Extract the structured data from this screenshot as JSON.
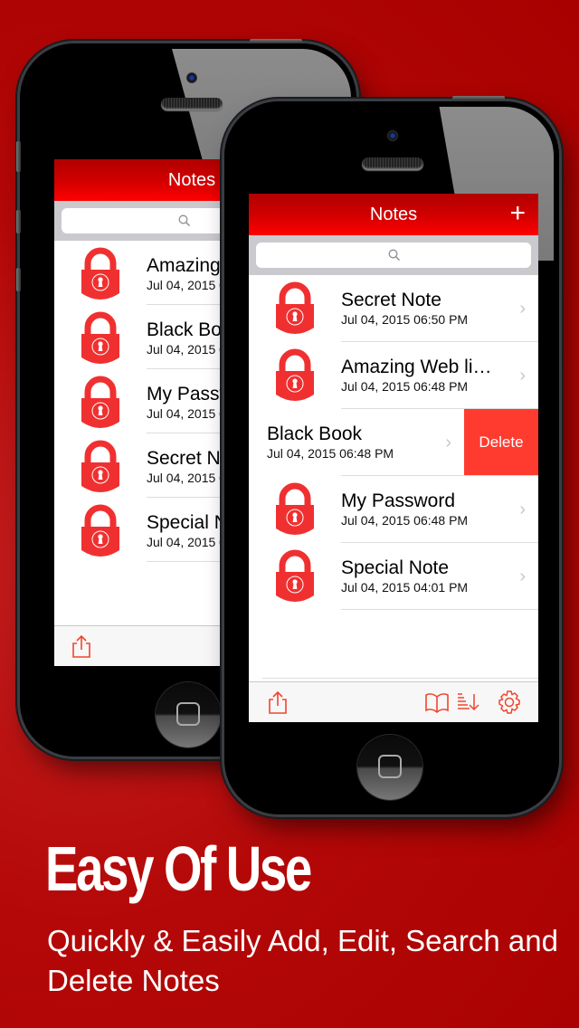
{
  "colors": {
    "accent": "#ff3b30",
    "navbar": "#e00000",
    "background": "#b40808"
  },
  "marketing": {
    "headline": "Easy Of Use",
    "subtitle": "Quickly & Easily Add, Edit, Search and Delete Notes"
  },
  "back_phone": {
    "navbar": {
      "title": "Notes"
    },
    "search": {
      "placeholder": ""
    },
    "notes": [
      {
        "title": "Amazing Web links",
        "date": "Jul 04, 2015 06:48 PM",
        "icon": "lock-icon"
      },
      {
        "title": "Black Book",
        "date": "Jul 04, 2015 06:48 PM",
        "icon": "lock-icon"
      },
      {
        "title": "My Password",
        "date": "Jul 04, 2015 06:48 PM",
        "icon": "lock-icon"
      },
      {
        "title": "Secret Note",
        "date": "Jul 04, 2015 04:01 PM",
        "icon": "lock-icon"
      },
      {
        "title": "Special Note",
        "date": "Jul 04, 2015 04:01 PM",
        "icon": "lock-icon"
      }
    ],
    "toolbar": [
      "share-icon"
    ]
  },
  "front_phone": {
    "navbar": {
      "title": "Notes",
      "add_label": "+"
    },
    "search": {
      "placeholder": ""
    },
    "notes": [
      {
        "title": "Secret Note",
        "date": "Jul 04, 2015 06:50 PM",
        "icon": "lock-icon"
      },
      {
        "title": "Amazing Web li…",
        "date": "Jul 04, 2015 06:48 PM",
        "icon": "lock-icon"
      },
      {
        "title": "Black Book",
        "date": "Jul 04, 2015 06:48 PM",
        "swiped": true,
        "delete_label": "Delete"
      },
      {
        "title": "My Password",
        "date": "Jul 04, 2015 06:48 PM",
        "icon": "lock-icon"
      },
      {
        "title": "Special Note",
        "date": "Jul 04, 2015 04:01 PM",
        "icon": "lock-icon"
      }
    ],
    "toolbar": [
      "share-icon",
      "book-icon",
      "sort-icon",
      "gear-icon"
    ]
  }
}
